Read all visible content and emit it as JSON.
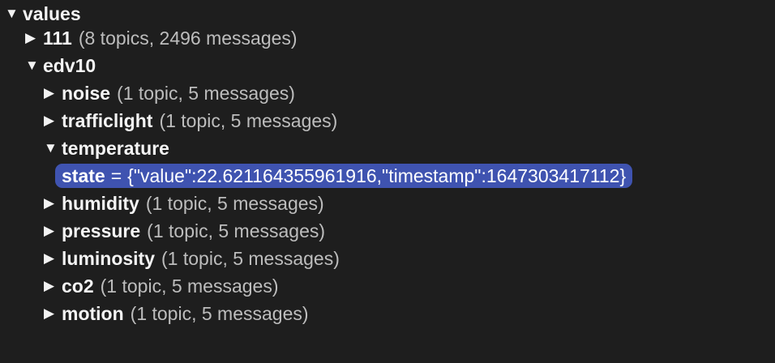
{
  "tree": {
    "root": {
      "arrow": "▼",
      "name": "values"
    },
    "n111": {
      "arrow": "▶",
      "name": "111",
      "meta": "(8 topics, 2496 messages)"
    },
    "edv10": {
      "arrow": "▼",
      "name": "edv10"
    },
    "noise": {
      "arrow": "▶",
      "name": "noise",
      "meta": "(1 topic, 5 messages)"
    },
    "trafficlight": {
      "arrow": "▶",
      "name": "trafficlight",
      "meta": "(1 topic, 5 messages)"
    },
    "temperature": {
      "arrow": "▼",
      "name": "temperature"
    },
    "state": {
      "name": "state",
      "eq": "=",
      "value": "{\"value\":22.621164355961916,\"timestamp\":1647303417112}"
    },
    "humidity": {
      "arrow": "▶",
      "name": "humidity",
      "meta": "(1 topic, 5 messages)"
    },
    "pressure": {
      "arrow": "▶",
      "name": "pressure",
      "meta": "(1 topic, 5 messages)"
    },
    "luminosity": {
      "arrow": "▶",
      "name": "luminosity",
      "meta": "(1 topic, 5 messages)"
    },
    "co2": {
      "arrow": "▶",
      "name": "co2",
      "meta": "(1 topic, 5 messages)"
    },
    "motion": {
      "arrow": "▶",
      "name": "motion",
      "meta": "(1 topic, 5 messages)"
    }
  },
  "colors": {
    "background": "#1e1e1e",
    "selection": "#3f53b0"
  }
}
